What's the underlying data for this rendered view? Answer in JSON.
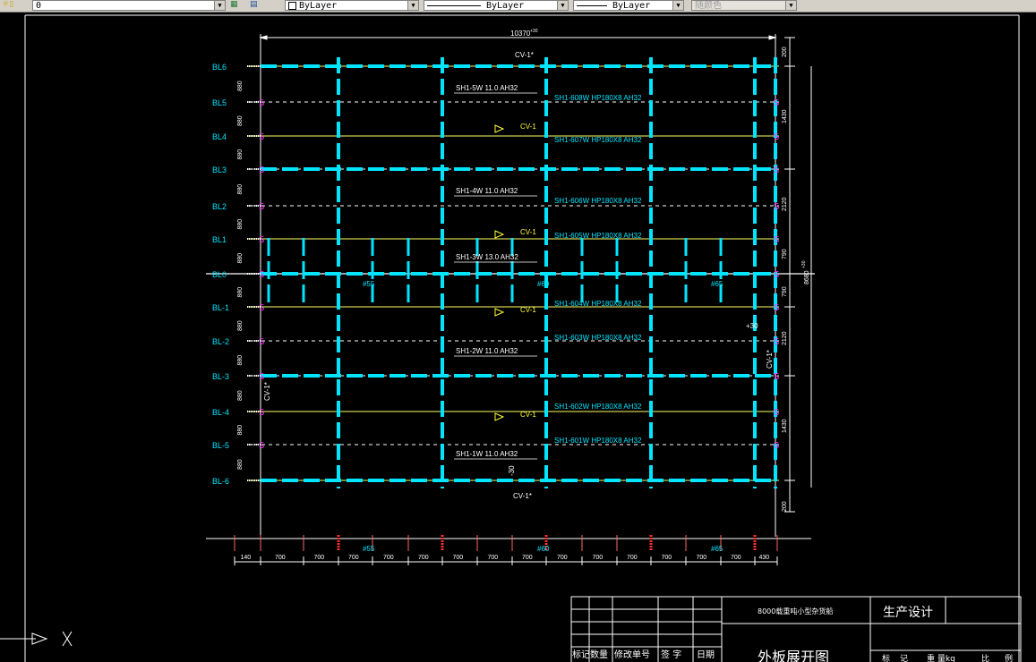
{
  "toolbar": {
    "layer_value": "0",
    "color_value": "ByLayer",
    "linetype_value": "ByLayer",
    "lineweight_value": "ByLayer",
    "plotstyle_value": "随颜色"
  },
  "drawing": {
    "top_dim": "10370",
    "top_dim_tol": "+30",
    "cv_top": "CV-1*",
    "cv_bottom": "CV-1*",
    "cv_mid": [
      "CV-1",
      "CV-1",
      "CV-1",
      "CV-1"
    ],
    "cv_left": "CV-1*",
    "cv_right": "CV-1*",
    "bl_labels": [
      "BL6",
      "BL5",
      "BL4",
      "BL3",
      "BL2",
      "BL1",
      "BL0",
      "BL-1",
      "BL-2",
      "BL-3",
      "BL-4",
      "BL-5",
      "BL-6"
    ],
    "left_dims": [
      "880",
      "880",
      "880",
      "880",
      "880",
      "880",
      "880",
      "880",
      "880",
      "880",
      "880",
      "880"
    ],
    "right_dims": [
      "200",
      "1430",
      "2120",
      "790",
      "790",
      "2120",
      "1430",
      "200"
    ],
    "right_total": "8680",
    "right_total_tol": "+30",
    "marker_plus30": "+30",
    "marker_minus30": "-30",
    "beam_labels": [
      "SH1-5W 11.0 AH32",
      "SH1-4W 11.0 AH32",
      "SH1-3W 13.0 AH32",
      "SH1-2W 11.0 AH32",
      "SH1-1W 11.0 AH32"
    ],
    "profile_labels": [
      "SH1-608W  HP180X8  AH32",
      "SH1-607W  HP180X8  AH32",
      "SH1-606W  HP180X8  AH32",
      "SH1-605W  HP180X8  AH32",
      "SH1-604W  HP180X8  AH32",
      "SH1-603W  HP180X8  AH32",
      "SH1-602W  HP180X8  AH32",
      "SH1-601W  HP180X8  AH32"
    ],
    "frame_labels": [
      "#55",
      "#60",
      "#65"
    ],
    "bottom_dims": [
      "140",
      "700",
      "700",
      "700",
      "700",
      "700",
      "700",
      "700",
      "700",
      "700",
      "700",
      "700",
      "700",
      "700",
      "700",
      "430"
    ]
  },
  "title_block": {
    "project": "8000载重吨小型杂货船",
    "company": "生产设计",
    "drawing_title": "外板展开图",
    "headers": [
      "标记",
      "数量",
      "修改单号",
      "签 字",
      "日期"
    ],
    "right_headers": [
      "标",
      "记",
      "重 量kg",
      "比",
      "例"
    ]
  }
}
